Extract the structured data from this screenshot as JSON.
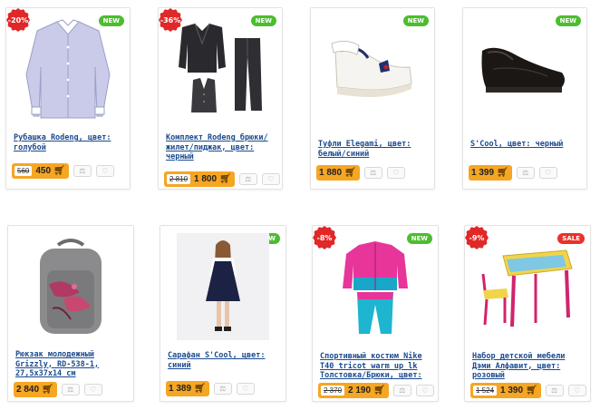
{
  "products": [
    {
      "title": "Рубашка Rodeng, цвет: голубой",
      "old_price": "560",
      "price": "450",
      "discount": "-20%",
      "badge": "NEW"
    },
    {
      "title": "Комплект Rodeng брюки/ жилет/пиджак, цвет: черный",
      "old_price": "2 810",
      "price": "1 800",
      "discount": "-36%",
      "badge": "NEW"
    },
    {
      "title": "Туфли Elegami, цвет: белый/синий",
      "old_price": "",
      "price": "1 880",
      "discount": "",
      "badge": "NEW"
    },
    {
      "title": "S'Cool, цвет: черный",
      "old_price": "",
      "price": "1 399",
      "discount": "",
      "badge": "NEW"
    },
    {
      "title": "Рюкзак молодежный Grizzly, RD-538-1, 27,5х37х14 см",
      "old_price": "",
      "price": "2 840",
      "discount": "",
      "badge": ""
    },
    {
      "title": "Сарафан S'Cool, цвет: синий",
      "old_price": "",
      "price": "1 389",
      "discount": "",
      "badge": "NEW"
    },
    {
      "title": "Спортивный костюм Nike T40 tricot warm up lk Толстовка/Брюки, цвет:",
      "old_price": "2 370",
      "price": "2 190",
      "discount": "-8%",
      "badge": "NEW"
    },
    {
      "title": "Набор детской мебели Дэми Алфавит, цвет: розовый",
      "old_price": "1 524",
      "price": "1 390",
      "discount": "-9%",
      "badge": "SALE"
    }
  ],
  "icons": {
    "cart": "cart-icon",
    "compare": "scales-icon",
    "wishlist": "heart-icon"
  },
  "colors": {
    "price_bg": "#f5a623",
    "new_badge": "#4cbd2f",
    "discount_badge": "#e02828",
    "link": "#1a4b8f"
  }
}
